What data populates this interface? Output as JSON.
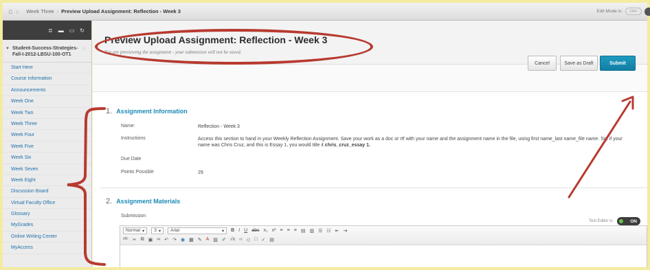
{
  "breadcrumb": {
    "items": [
      "Week Three",
      "Preview Upload Assignment: Reflection - Week 3"
    ]
  },
  "edit_mode": {
    "label": "Edit Mode is:",
    "state": "OFF"
  },
  "sidebar": {
    "course_name": "Student-Success-Strategies-Fall-I-2012-LBSU-100-OT1",
    "items": [
      "Start Here",
      "Course Information",
      "Announcements",
      "Week One",
      "Week Two",
      "Week Three",
      "Week Four",
      "Week Five",
      "Week Six",
      "Week Seven",
      "Week Eight",
      "Discussion Board",
      "Virtual Faculty Office",
      "Glossary",
      "MyGrades",
      "Online Writing Center",
      "MyAccess"
    ]
  },
  "header": {
    "title": "Preview Upload Assignment: Reflection - Week 3",
    "note": "You are previewing the assignment - your submission will not be saved."
  },
  "buttons": {
    "cancel": "Cancel",
    "save_draft": "Save as Draft",
    "submit": "Submit"
  },
  "assignment_info": {
    "number": "1.",
    "title": "Assignment Information",
    "name_label": "Name:",
    "name_value": "Reflection - Week 3",
    "instructions_label": "Instructions",
    "instructions_text": "Access this section to hand in your Weekly Reflection Assignment. Save your work as a doc or rtf with your name and the assignment name in the file, using first name_last name_file name. So, if your name was Chris Cruz, and this is Essay 1, you would title it ",
    "instructions_example": "chris_cruz_essay 1.",
    "due_label": "Due Date",
    "points_label": "Points Possible",
    "points_value": "29"
  },
  "assignment_materials": {
    "number": "2.",
    "title": "Assignment Materials",
    "submission_label": "Submission",
    "text_editor_label": "Text Editor is:",
    "text_editor_state": "ON"
  },
  "editor_toolbar": {
    "format": "Normal",
    "size": "3",
    "font": "Arial"
  },
  "colors": {
    "accent": "#1d8ab5",
    "annotation": "#b73a30",
    "submit": "#137ea3"
  }
}
